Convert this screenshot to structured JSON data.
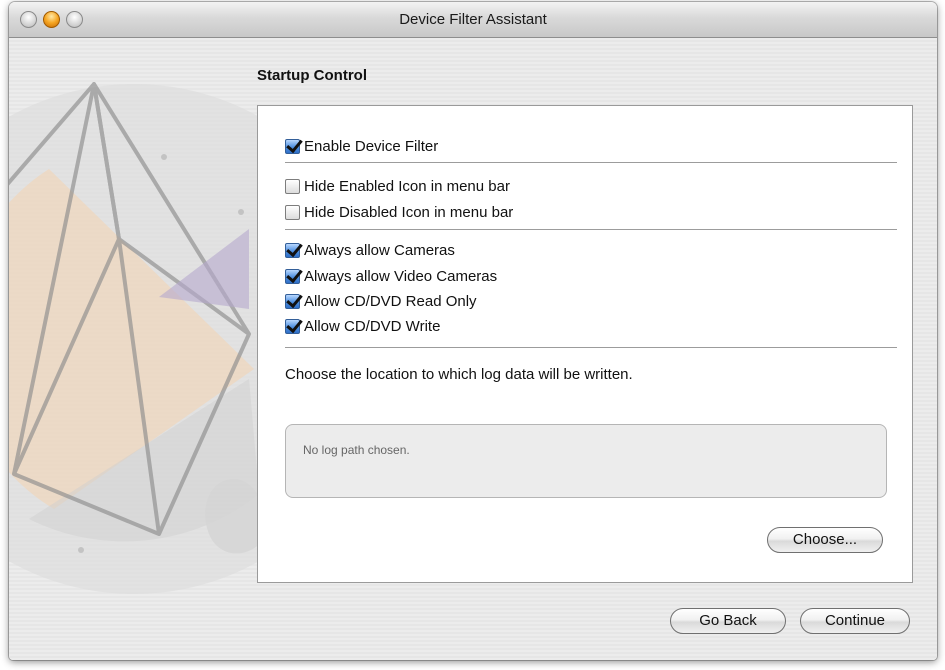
{
  "window": {
    "title": "Device Filter Assistant"
  },
  "section": {
    "title": "Startup Control"
  },
  "options": {
    "enable_device_filter": {
      "label": "Enable Device Filter",
      "checked": true
    },
    "hide_enabled_icon": {
      "label": "Hide Enabled Icon in menu bar",
      "checked": false
    },
    "hide_disabled_icon": {
      "label": "Hide Disabled Icon in menu bar",
      "checked": false
    },
    "allow_cameras": {
      "label": "Always allow Cameras",
      "checked": true
    },
    "allow_video_cameras": {
      "label": "Always allow Video Cameras",
      "checked": true
    },
    "allow_cd_read": {
      "label": "Allow CD/DVD Read Only",
      "checked": true
    },
    "allow_cd_write": {
      "label": "Allow CD/DVD Write",
      "checked": true
    }
  },
  "log": {
    "label": "Choose the location to which log data will be written.",
    "path_text": "No log path chosen.",
    "choose_label": "Choose..."
  },
  "footer": {
    "back_label": "Go Back",
    "continue_label": "Continue"
  },
  "icons": {
    "close": "close-button-icon",
    "minimize": "minimize-button-icon",
    "zoom": "zoom-button-icon",
    "backdrop": "assistant-backdrop-icon"
  },
  "colors": {
    "checkbox_accent": "#4d8fe0",
    "minimize_button": "#f6a623"
  }
}
